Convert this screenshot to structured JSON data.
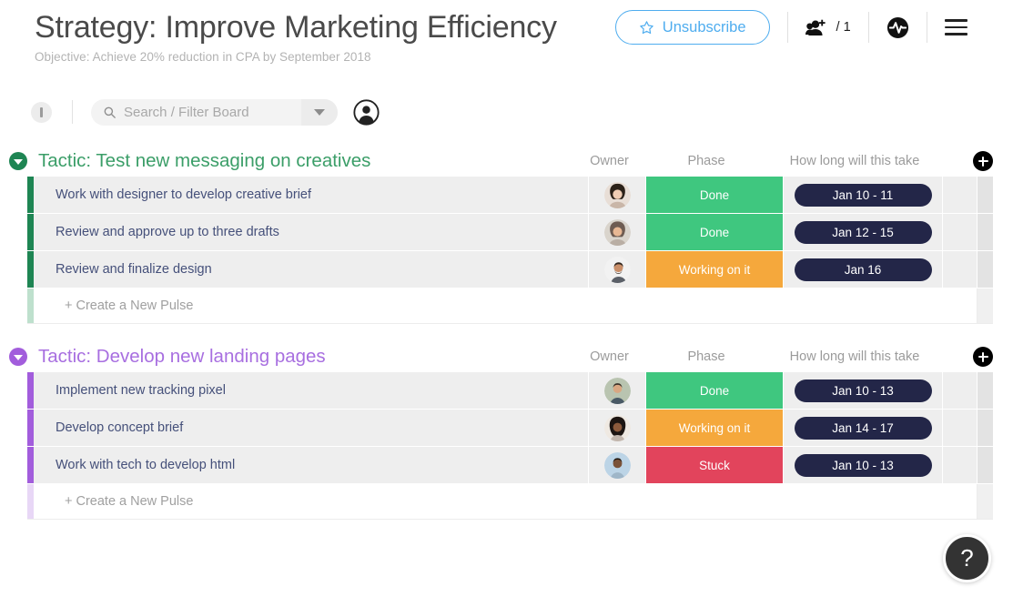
{
  "header": {
    "title": "Strategy: Improve Marketing Efficiency",
    "subtitle": "Objective: Achieve 20% reduction in CPA by September 2018",
    "subscribe_label": "Unsubscribe",
    "star_icon": "star-outline-icon",
    "people_icon": "add-people-icon",
    "people_count": "/ 1",
    "activity_icon": "activity-pulse-icon",
    "menu_icon": "hamburger-menu-icon",
    "accent_blue": "#4FADEF"
  },
  "toolbar": {
    "filter_icon": "filter-circle-icon",
    "search_icon": "search-icon",
    "search_value": "",
    "search_placeholder": "Search / Filter Board",
    "dropdown_icon": "chevron-down-icon",
    "person_icon": "person-circle-icon"
  },
  "columns": {
    "owner": "Owner",
    "phase": "Phase",
    "date": "How long will this take",
    "add_icon": "plus-circle-icon"
  },
  "statuses": {
    "done": {
      "label": "Done",
      "color": "#3fc77f"
    },
    "working": {
      "label": "Working on it",
      "color": "#f5a83c"
    },
    "stuck": {
      "label": "Stuck",
      "color": "#e2445c"
    }
  },
  "new_pulse_label": "+ Create a New Pulse",
  "help": {
    "label": "?",
    "icon": "help-question-icon"
  },
  "groups": [
    {
      "title": "Tactic: Test new messaging on creatives",
      "color": "#1e8553",
      "collapse_icon": "collapse-chevron-icon",
      "rows": [
        {
          "name": "Work with designer to develop creative brief",
          "owner_avatar": "avatar-dark-hair-woman",
          "status": "Done",
          "status_color": "#3fc77f",
          "date": "Jan 10 - 11"
        },
        {
          "name": "Review and approve up to three drafts",
          "owner_avatar": "avatar-woman-glasses",
          "status": "Done",
          "status_color": "#3fc77f",
          "date": "Jan 12 - 15"
        },
        {
          "name": "Review and finalize design",
          "owner_avatar": "avatar-bearded-man",
          "status": "Working on it",
          "status_color": "#f5a83c",
          "date": "Jan 16"
        }
      ]
    },
    {
      "title": "Tactic: Develop new landing pages",
      "color": "#a25ddc",
      "collapse_icon": "collapse-chevron-icon",
      "rows": [
        {
          "name": "Implement new tracking pixel",
          "owner_avatar": "avatar-man-outdoors",
          "status": "Done",
          "status_color": "#3fc77f",
          "date": "Jan 10 - 13"
        },
        {
          "name": "Develop concept brief",
          "owner_avatar": "avatar-woman-long-hair",
          "status": "Working on it",
          "status_color": "#f5a83c",
          "date": "Jan 14 - 17"
        },
        {
          "name": "Work with tech to develop html",
          "owner_avatar": "avatar-man-blue-bg",
          "status": "Stuck",
          "status_color": "#e2445c",
          "date": "Jan 10 - 13"
        }
      ]
    }
  ]
}
